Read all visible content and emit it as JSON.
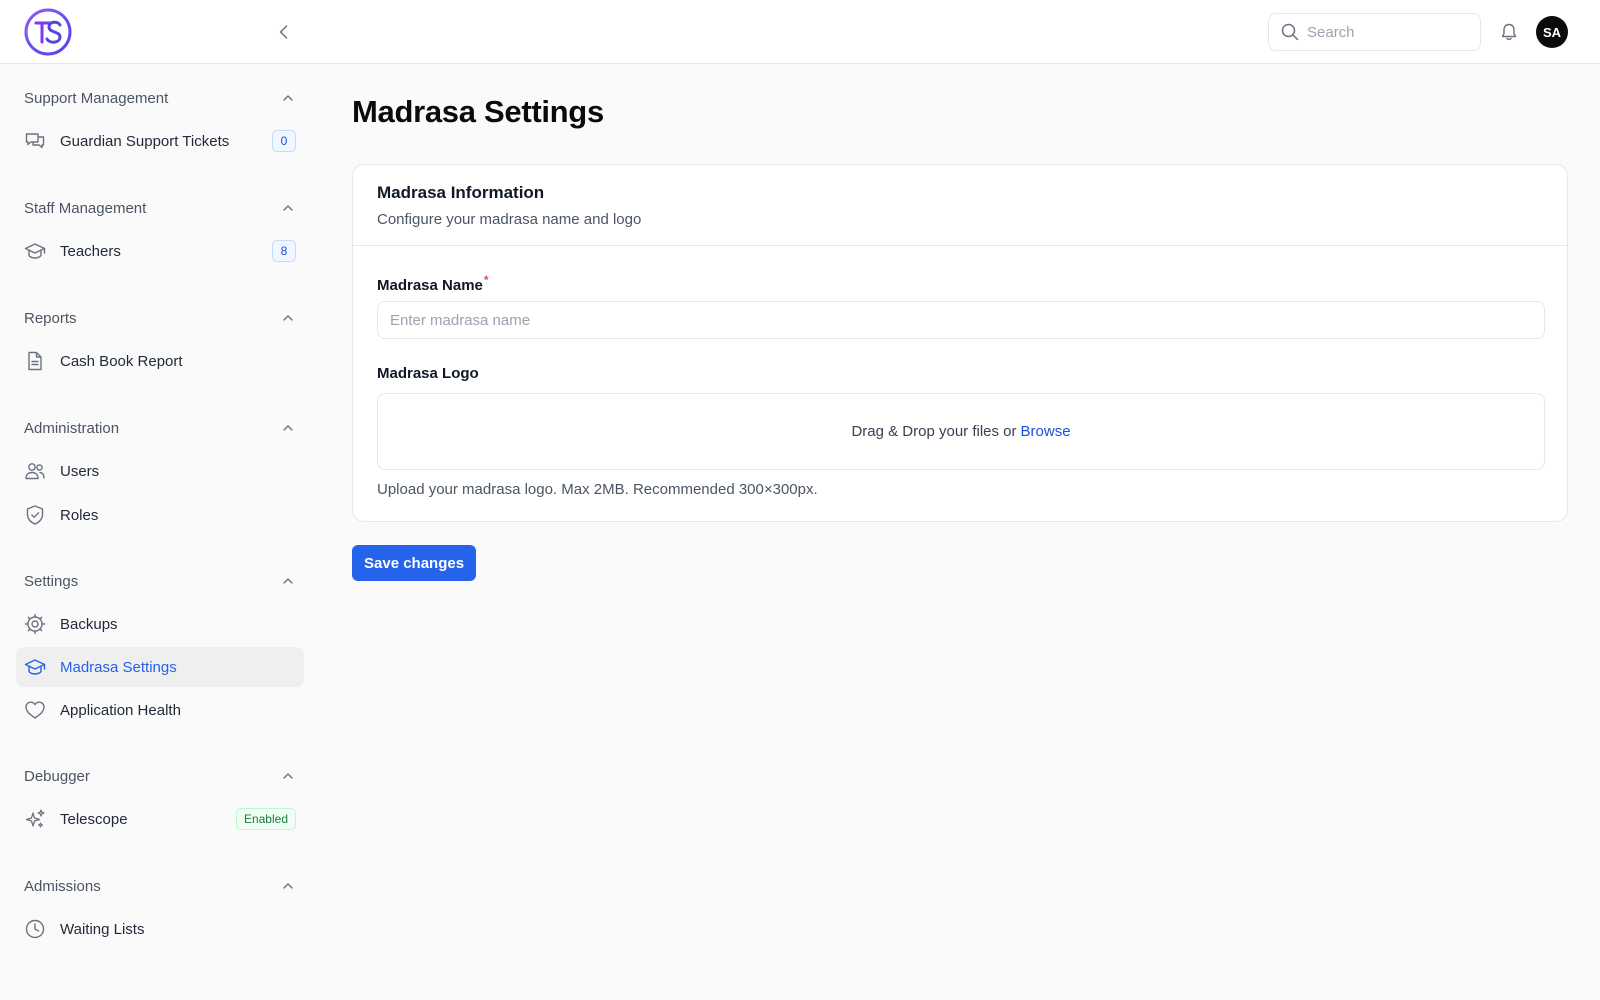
{
  "app": {
    "logo_text": "TS"
  },
  "header": {
    "search_placeholder": "Search",
    "avatar_initials": "SA"
  },
  "sidebar": {
    "sections": [
      {
        "title": "Support Management",
        "items": [
          {
            "label": "Guardian Support Tickets",
            "icon": "chat-bubbles-icon",
            "badge": "0"
          }
        ]
      },
      {
        "title": "Staff Management",
        "items": [
          {
            "label": "Teachers",
            "icon": "graduation-cap-icon",
            "badge": "8"
          }
        ]
      },
      {
        "title": "Reports",
        "items": [
          {
            "label": "Cash Book Report",
            "icon": "document-icon"
          }
        ]
      },
      {
        "title": "Administration",
        "items": [
          {
            "label": "Users",
            "icon": "users-icon"
          },
          {
            "label": "Roles",
            "icon": "shield-check-icon"
          }
        ]
      },
      {
        "title": "Settings",
        "items": [
          {
            "label": "Backups",
            "icon": "cog-icon"
          },
          {
            "label": "Madrasa Settings",
            "icon": "graduation-cap-icon",
            "active": true
          },
          {
            "label": "Application Health",
            "icon": "heart-icon"
          }
        ]
      },
      {
        "title": "Debugger",
        "items": [
          {
            "label": "Telescope",
            "icon": "sparkles-icon",
            "status": "Enabled"
          }
        ]
      },
      {
        "title": "Admissions",
        "items": [
          {
            "label": "Waiting Lists",
            "icon": "clock-icon"
          }
        ]
      }
    ]
  },
  "main": {
    "title": "Madrasa Settings",
    "card": {
      "title": "Madrasa Information",
      "subtitle": "Configure your madrasa name and logo",
      "name_label": "Madrasa Name",
      "name_required": "*",
      "name_placeholder": "Enter madrasa name",
      "name_value": "",
      "logo_label": "Madrasa Logo",
      "dropzone_text": "Drag & Drop your files or",
      "browse_label": "Browse",
      "help_text": "Upload your madrasa logo. Max 2MB. Recommended 300×300px."
    },
    "save_label": "Save changes"
  },
  "colors": {
    "accent": "#2563eb",
    "logo_purple": "#7c3aed",
    "required": "#ef4444",
    "enabled_green": "#15803d"
  }
}
